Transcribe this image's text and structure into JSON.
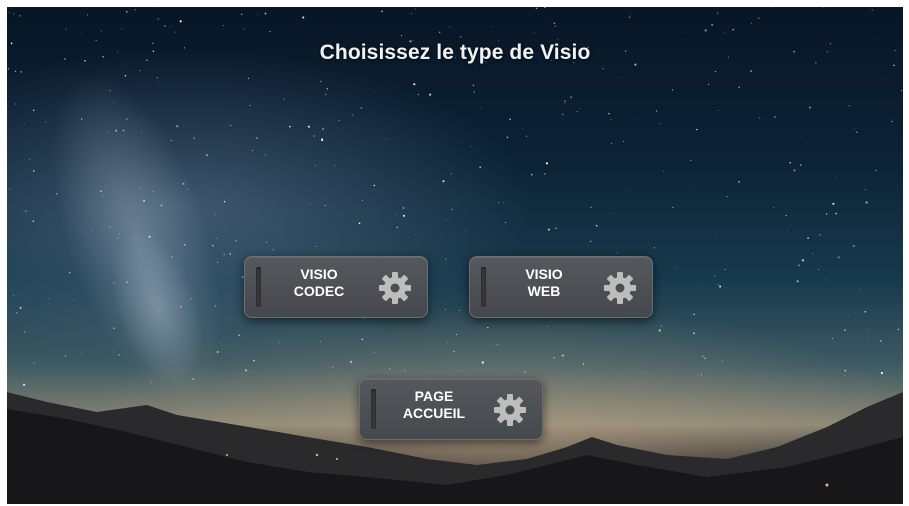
{
  "screen": {
    "title": "Choisissez le type de Visio"
  },
  "buttons": [
    {
      "line1": "VISIO",
      "line2": "CODEC",
      "icon": "gear-icon"
    },
    {
      "line1": "VISIO",
      "line2": "WEB",
      "icon": "gear-icon"
    },
    {
      "line1": "PAGE",
      "line2": "ACCUEIL",
      "icon": "gear-icon"
    }
  ],
  "colors": {
    "button_bg": "#4c4f53",
    "gear": "#bdbdbd",
    "text": "#ffffff"
  }
}
